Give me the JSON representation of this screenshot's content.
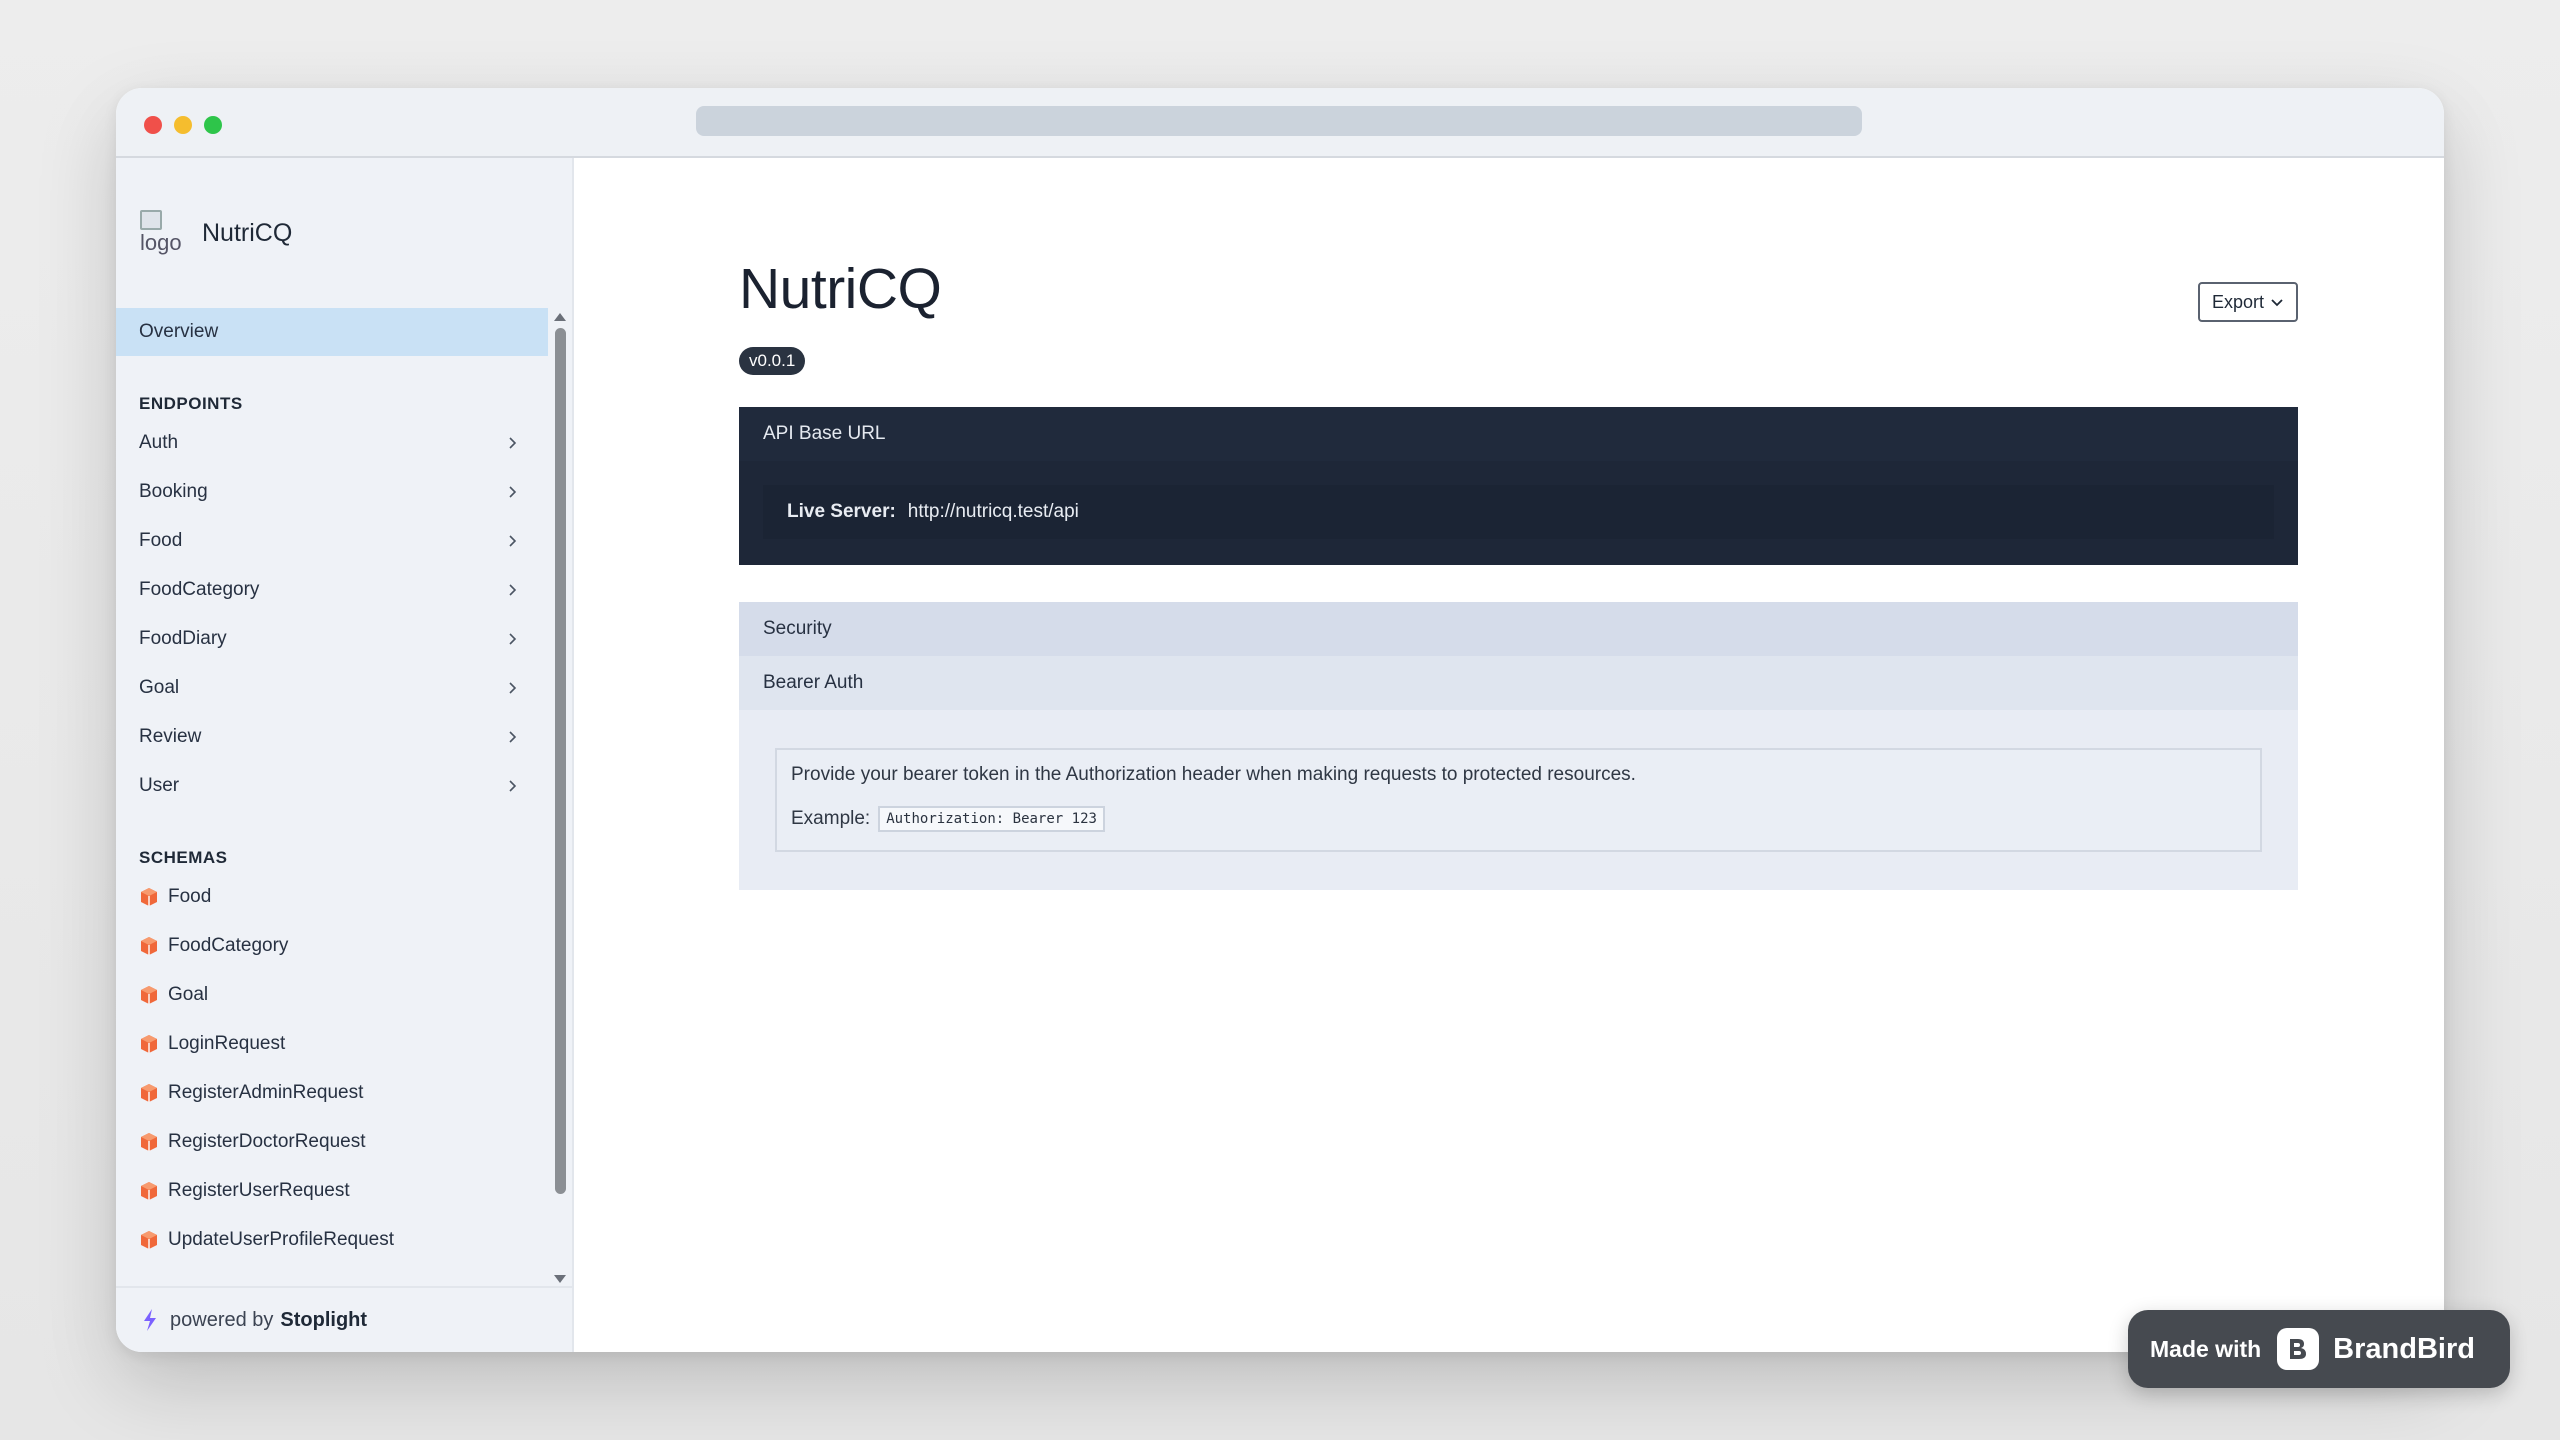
{
  "window": {
    "controls": [
      "close",
      "minimize",
      "maximize"
    ]
  },
  "sidebar": {
    "logo_alt": "logo",
    "app_name": "NutriCQ",
    "overview_label": "Overview",
    "endpoints_heading": "ENDPOINTS",
    "endpoints": [
      "Auth",
      "Booking",
      "Food",
      "FoodCategory",
      "FoodDiary",
      "Goal",
      "Review",
      "User"
    ],
    "schemas_heading": "SCHEMAS",
    "schemas": [
      "Food",
      "FoodCategory",
      "Goal",
      "LoginRequest",
      "RegisterAdminRequest",
      "RegisterDoctorRequest",
      "RegisterUserRequest",
      "UpdateUserProfileRequest"
    ],
    "footer_prefix": "powered by",
    "footer_brand": "Stoplight"
  },
  "main": {
    "title": "NutriCQ",
    "version": "v0.0.1",
    "export_label": "Export",
    "api_base_url_label": "API Base URL",
    "server_label": "Live Server:",
    "server_url": "http://nutricq.test/api",
    "security_label": "Security",
    "auth_label": "Bearer Auth",
    "auth_description": "Provide your bearer token in the Authorization header when making requests to protected resources.",
    "example_label": "Example:",
    "example_code": "Authorization: Bearer 123"
  },
  "badge": {
    "made_with": "Made with",
    "brand": "BrandBird"
  },
  "colors": {
    "accent": "#c9e1f5",
    "schema_icon": "#f0683a",
    "dark_panel": "#1e2738"
  }
}
